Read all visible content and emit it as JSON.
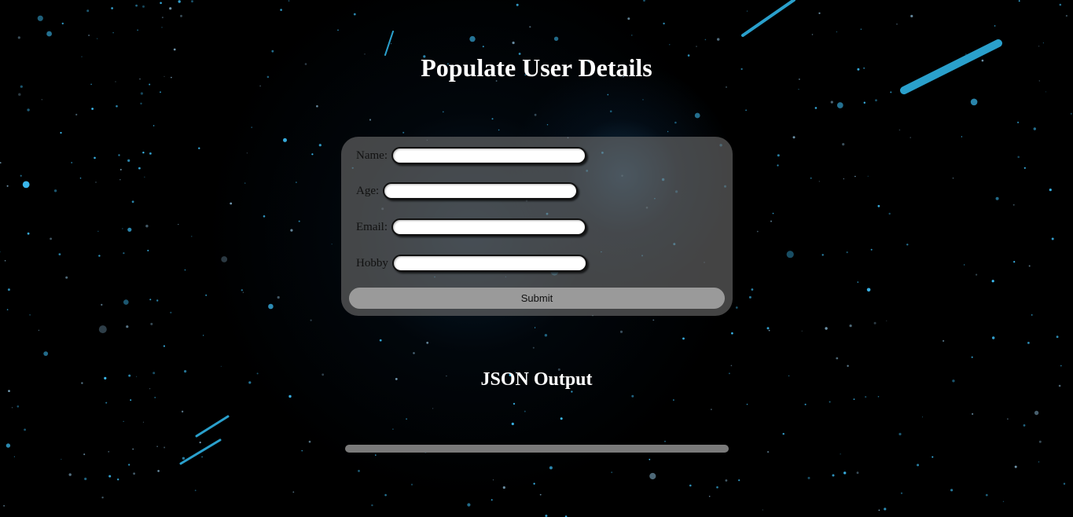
{
  "page_title": "Populate User Details",
  "form": {
    "fields": [
      {
        "label": "Name:",
        "value": ""
      },
      {
        "label": "Age:",
        "value": ""
      },
      {
        "label": "Email:",
        "value": ""
      },
      {
        "label": "Hobby",
        "value": ""
      }
    ],
    "submit_label": "Submit"
  },
  "output": {
    "title": "JSON Output",
    "content": ""
  }
}
